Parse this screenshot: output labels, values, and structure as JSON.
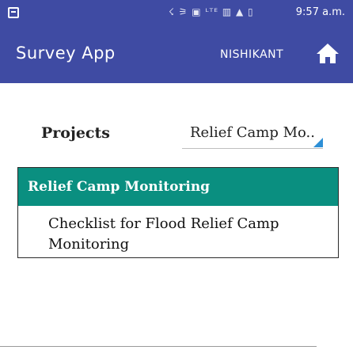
{
  "status_bar": {
    "icons_text": "☇ ⚞ ▣ ᴸᵀᴱ ▥ ▲ ▯",
    "time": "9:57 a.m."
  },
  "app_bar": {
    "title": "Survey App",
    "user": "NISHIKANT",
    "home_icon": "home-icon",
    "color": "#3f4ba3"
  },
  "form": {
    "projects_label": "Projects",
    "projects_selected": "Relief Camp Mo.."
  },
  "card": {
    "header": "Relief Camp Monitoring",
    "header_color": "#0a8f80",
    "item": "Checklist for Flood Relief Camp Monitoring"
  }
}
